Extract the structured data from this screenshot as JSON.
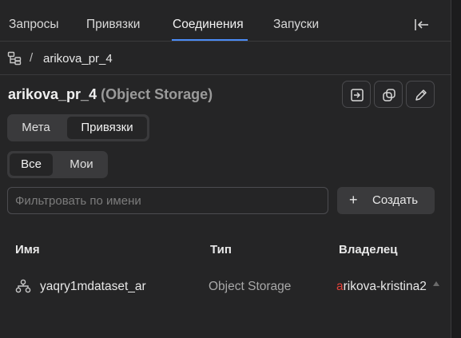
{
  "tabs": [
    {
      "label": "Запросы"
    },
    {
      "label": "Привязки"
    },
    {
      "label": "Соединения"
    },
    {
      "label": "Запуски"
    }
  ],
  "active_tab": "Соединения",
  "breadcrumb": {
    "separator": "/",
    "current": "arikova_pr_4"
  },
  "header": {
    "title": "arikova_pr_4",
    "subtitle": "(Object Storage)"
  },
  "actions": {
    "icons": [
      "open-in-editor-icon",
      "copy-icon",
      "edit-icon"
    ]
  },
  "view_switch": {
    "options": [
      "Мета",
      "Привязки"
    ],
    "selected": "Привязки"
  },
  "scope_switch": {
    "options": [
      "Все",
      "Мои"
    ],
    "selected": "Все"
  },
  "filter": {
    "placeholder": "Фильтровать по имени",
    "value": ""
  },
  "create_button": {
    "icon": "+",
    "label": "Создать"
  },
  "table": {
    "columns": [
      "Имя",
      "Тип",
      "Владелец"
    ],
    "rows": [
      {
        "name": "yaqry1mdataset_ar",
        "type": "Object Storage",
        "owner_initial": "a",
        "owner_rest": "rikova-kristina2"
      }
    ]
  },
  "colors": {
    "accent": "#4b8cf5",
    "owner_avatar": "#e0423a"
  }
}
